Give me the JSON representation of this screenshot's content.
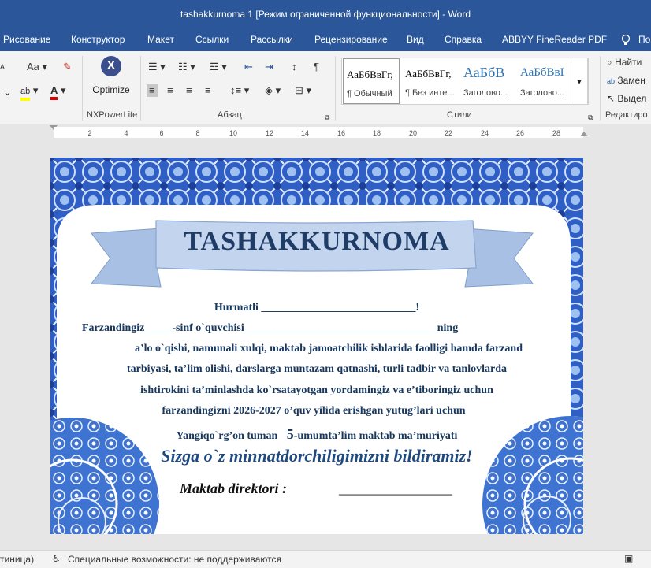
{
  "window": {
    "title": "tashakkurnoma 1 [Режим ограниченной функциональности]  -  Word"
  },
  "tabs": [
    "Рисование",
    "Конструктор",
    "Макет",
    "Ссылки",
    "Рассылки",
    "Рецензирование",
    "Вид",
    "Справка",
    "ABBYY FineReader PDF",
    "По"
  ],
  "ribbon": {
    "font_size_label": "Aa",
    "optimize_label": "Optimize",
    "group_nxpowerlite": "NXPowerLite",
    "group_paragraph": "Абзац",
    "group_styles": "Стили",
    "group_editing": "Редактиро",
    "styles": [
      {
        "sample": "АаБбВвГг,",
        "name": "¶ Обычный"
      },
      {
        "sample": "АаБбВвГг,",
        "name": "¶ Без инте..."
      },
      {
        "sample": "АаБбВ",
        "name": "Заголово..."
      },
      {
        "sample": "АаБбВвI",
        "name": "Заголово..."
      }
    ],
    "editing": {
      "find": "Найти",
      "replace": "Замен",
      "select": "Выдел"
    }
  },
  "ruler": {
    "numbers": [
      "2",
      "4",
      "6",
      "8",
      "10",
      "12",
      "14",
      "16",
      "18",
      "20",
      "22",
      "24",
      "26",
      "28"
    ]
  },
  "certificate": {
    "banner_title": "TASHAKKURNOMA",
    "line1": "Hurmatli ____________________________!",
    "line2": "Farzandingiz_____-sinf o`quvchisi___________________________________ning",
    "line3": "a’lo o`qishi, namunali xulqi, maktab jamoatchilik ishlarida faolligi hamda farzand",
    "line4": "tarbiyasi,  ta’lim olishi, darslarga muntazam qatnashi,  turli tadbir va tanlovlarda",
    "line5": "ishtirokini ta’minlashda ko`rsatayotgan yordamingiz va e’tiboringiz uchun",
    "line6": "farzandingizni 2026-2027 o’quv yilida erishgan yutug’lari uchun",
    "line7_pre": "Yangiqo`rg’on tuman",
    "line7_num": "5",
    "line7_post": "-umumta’lim  maktab ma’muriyati",
    "gratitude": "Sizga o`z minnatdorchiligimizni bildiramiz!",
    "director_label": "Maktab direktori :",
    "signature_line": "________________"
  },
  "statusbar": {
    "page_info": "тиница)",
    "accessibility": "Специальные возможности: не поддерживаются"
  },
  "colors": {
    "word_blue": "#2b579a",
    "cert_text": "#17375e",
    "banner": "#b9cde9"
  }
}
